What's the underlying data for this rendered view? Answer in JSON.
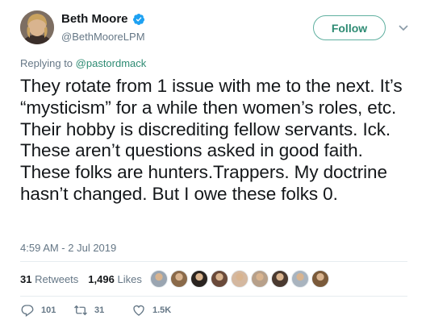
{
  "author": {
    "name": "Beth Moore",
    "handle": "@BethMooreLPM",
    "verified": true,
    "avatar_icon": "profile-photo"
  },
  "follow_label": "Follow",
  "reply_prefix": "Replying to ",
  "reply_to": "@pastordmack",
  "text": "They rotate from 1 issue with me to the next. It’s “mysticism” for a while then women’s roles, etc. Their hobby is discrediting fellow servants. Ick. These aren’t questions asked in good faith. These folks are hunters.Trappers. My doctrine hasn’t changed. But I owe these folks 0.",
  "timestamp": "4:59 AM - 2 Jul 2019",
  "stats": {
    "retweets_count": "31",
    "retweets_label": "Retweets",
    "likes_count": "1,496",
    "likes_label": "Likes"
  },
  "likers": [
    {
      "color": "#9aa5b1"
    },
    {
      "color": "#8a6a4a"
    },
    {
      "color": "#2a2420"
    },
    {
      "color": "#6a4a3a"
    },
    {
      "color": "#d4b8a0"
    },
    {
      "color": "#b7a08a"
    },
    {
      "color": "#4a3a30"
    },
    {
      "color": "#a9b4bf"
    },
    {
      "color": "#7a5a3a"
    }
  ],
  "actions": {
    "reply_count": "101",
    "retweet_count": "31",
    "like_count": "1.5K"
  },
  "colors": {
    "accent": "#2e8b73",
    "muted": "#657786",
    "verified": "#1da1f2"
  }
}
